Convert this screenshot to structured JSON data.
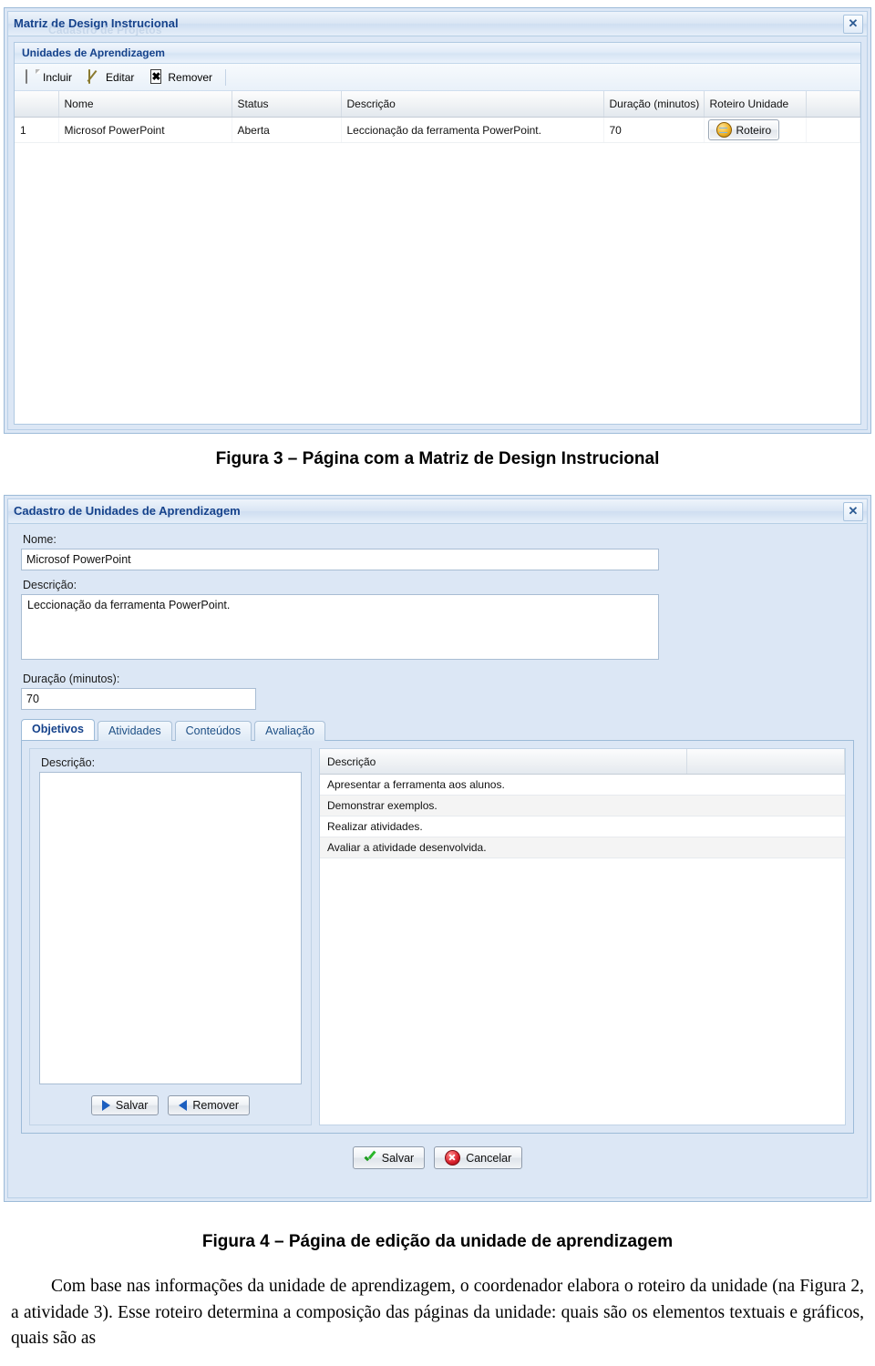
{
  "window1": {
    "title": "Matriz de Design Instrucional",
    "ghost_title": "Cadastro de Projetos",
    "close_label": "✕",
    "panel_title": "Unidades de Aprendizagem",
    "toolbar": [
      {
        "label": "Incluir",
        "icon": "new-page-icon"
      },
      {
        "label": "Editar",
        "icon": "pencil-icon"
      },
      {
        "label": "Remover",
        "icon": "x-icon"
      }
    ],
    "grid": {
      "columns": [
        "",
        "Nome",
        "Status",
        "Descrição",
        "Duração (minutos)",
        "Roteiro Unidade",
        ""
      ],
      "rows": [
        {
          "index": "1",
          "nome": "Microsof PowerPoint",
          "status": "Aberta",
          "descricao": "Leccionação da ferramenta PowerPoint.",
          "duracao": "70",
          "roteiro_button": "Roteiro"
        }
      ]
    }
  },
  "caption3": "Figura 3 – Página com a Matriz de Design Instrucional",
  "window2": {
    "title": "Cadastro de Unidades de Aprendizagem",
    "close_label": "✕",
    "fields": {
      "nome_label": "Nome:",
      "nome_value": "Microsof PowerPoint",
      "descricao_label": "Descrição:",
      "descricao_value": "Leccionação da ferramenta PowerPoint.",
      "duracao_label": "Duração (minutos):",
      "duracao_value": "70"
    },
    "tabs": [
      {
        "label": "Objetivos",
        "active": true
      },
      {
        "label": "Atividades",
        "active": false
      },
      {
        "label": "Conteúdos",
        "active": false
      },
      {
        "label": "Avaliação",
        "active": false
      }
    ],
    "left_pane": {
      "descricao_label": "Descrição:",
      "descricao_value": "",
      "salvar_label": "Salvar",
      "remover_label": "Remover"
    },
    "objectives_grid": {
      "columns": [
        "Descrição",
        ""
      ],
      "rows": [
        "Apresentar a ferramenta aos alunos.",
        "Demonstrar exemplos.",
        "Realizar atividades.",
        "Avaliar a atividade desenvolvida."
      ]
    },
    "footer": {
      "salvar_label": "Salvar",
      "cancelar_label": "Cancelar"
    }
  },
  "caption4": "Figura 4 – Página de edição da unidade de aprendizagem",
  "body_text": {
    "paragraph": "Com base nas informações da unidade de aprendizagem, o coordenador elabora o roteiro da unidade (na Figura 2, a atividade 3). Esse roteiro determina a composição das páginas da unidade: quais são os elementos textuais e gráficos, quais são as"
  }
}
